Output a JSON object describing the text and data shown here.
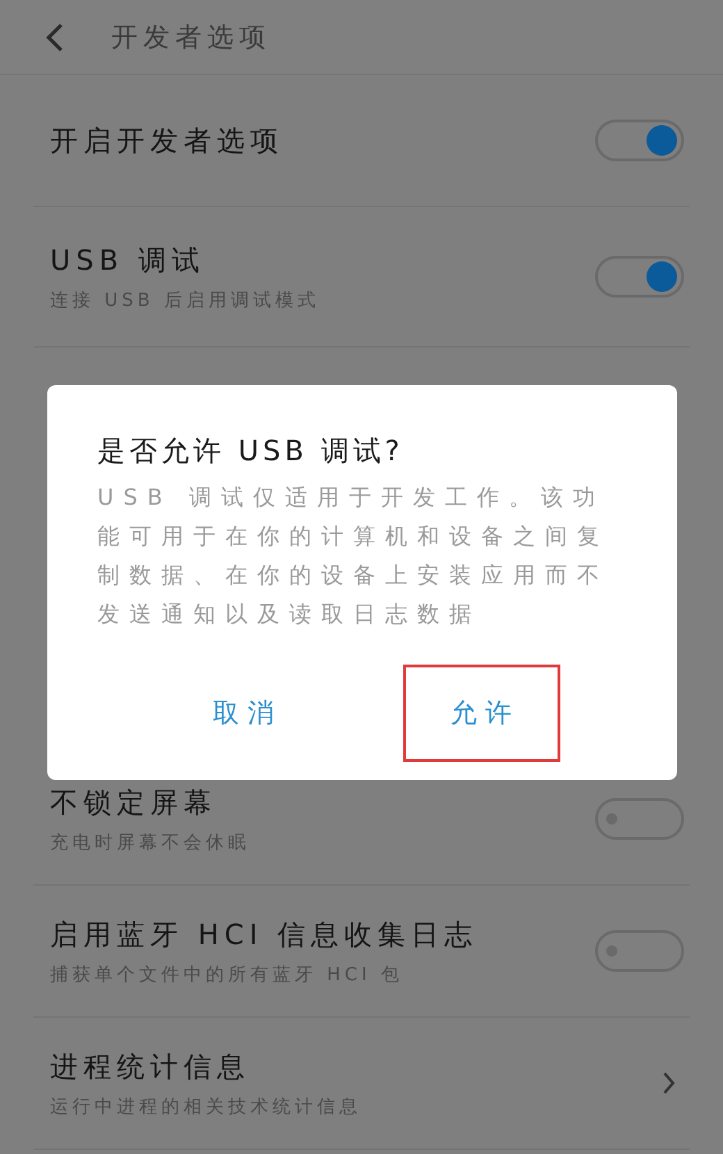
{
  "header": {
    "title": "开发者选项"
  },
  "rows_top": [
    {
      "title": "开启开发者选项",
      "kind": "toggle",
      "on": true
    },
    {
      "title": "USB 调试",
      "subtitle": "连接 USB 后启用调试模式",
      "kind": "toggle",
      "on": true
    }
  ],
  "rows_bottom": [
    {
      "title": "不锁定屏幕",
      "subtitle": "充电时屏幕不会休眠",
      "kind": "toggle",
      "on": false
    },
    {
      "title": "启用蓝牙 HCI 信息收集日志",
      "subtitle": "捕获单个文件中的所有蓝牙 HCI 包",
      "kind": "toggle",
      "on": false
    },
    {
      "title": "进程统计信息",
      "subtitle": "运行中进程的相关技术统计信息",
      "kind": "link"
    }
  ],
  "dialog": {
    "title": "是否允许 USB 调试?",
    "message": "USB 调试仅适用于开发工作。该功能可用于在你的计算机和设备之间复制数据、在你的设备上安装应用而不发送通知以及读取日志数据",
    "buttons": [
      {
        "label": "取消",
        "highlighted": false
      },
      {
        "label": "允许",
        "highlighted": true
      }
    ]
  }
}
